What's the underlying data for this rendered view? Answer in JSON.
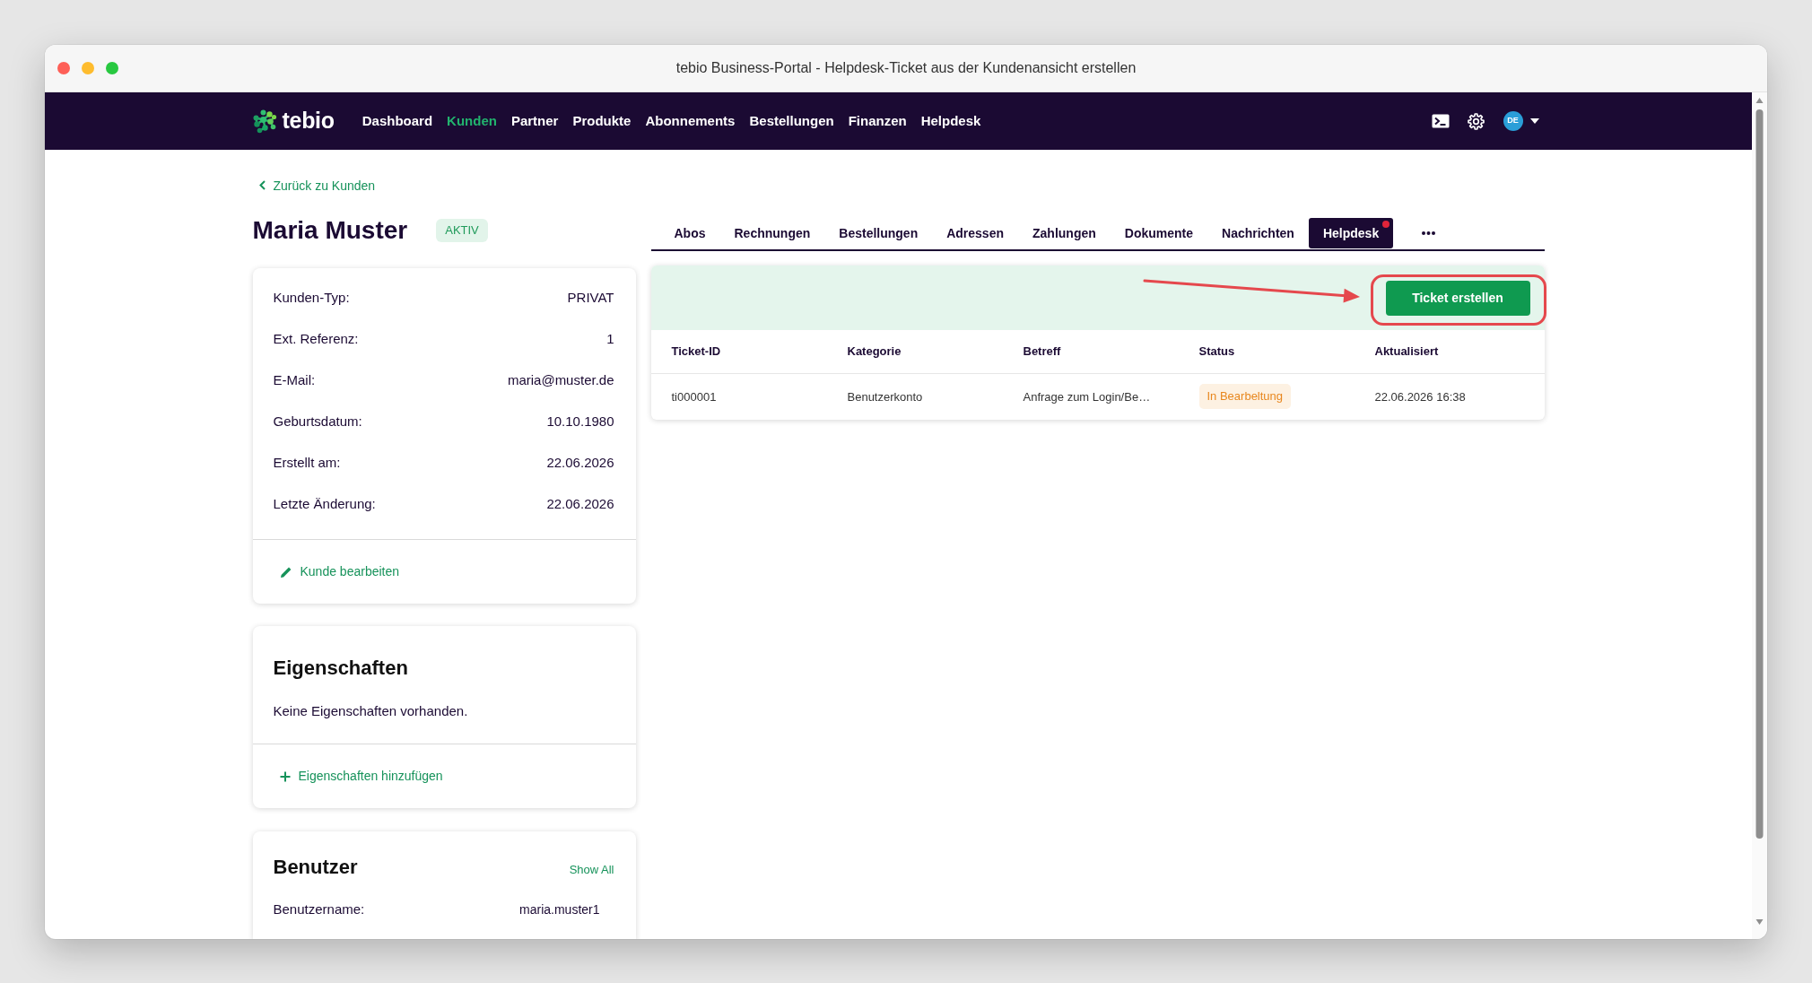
{
  "window": {
    "title": "tebio Business-Portal - Helpdesk-Ticket aus der Kundenansicht erstellen"
  },
  "navbar": {
    "brand": "tebio",
    "links": [
      {
        "label": "Dashboard",
        "selected": false
      },
      {
        "label": "Kunden",
        "selected": true
      },
      {
        "label": "Partner",
        "selected": false
      },
      {
        "label": "Produkte",
        "selected": false
      },
      {
        "label": "Abonnements",
        "selected": false
      },
      {
        "label": "Bestellungen",
        "selected": false
      },
      {
        "label": "Finanzen",
        "selected": false
      },
      {
        "label": "Helpdesk",
        "selected": false
      }
    ],
    "user_initials": "DE"
  },
  "back_link": "Zurück zu Kunden",
  "customer": {
    "name": "Maria Muster",
    "status": "AKTIV"
  },
  "details_card": {
    "fields": [
      {
        "label": "Kunden-Typ:",
        "value": "PRIVAT"
      },
      {
        "label": "Ext. Referenz:",
        "value": "1"
      },
      {
        "label": "E-Mail:",
        "value": "maria@muster.de"
      },
      {
        "label": "Geburtsdatum:",
        "value": "10.10.1980"
      },
      {
        "label": "Erstellt am:",
        "value": "22.06.2026"
      },
      {
        "label": "Letzte Änderung:",
        "value": "22.06.2026"
      }
    ],
    "edit_link": "Kunde bearbeiten"
  },
  "properties_card": {
    "title": "Eigenschaften",
    "empty_text": "Keine Eigenschaften vorhanden.",
    "add_link": "Eigenschaften hinzufügen"
  },
  "users_card": {
    "title": "Benutzer",
    "show_all_link": "Show All",
    "fields": [
      {
        "label": "Benutzername:",
        "value": "maria.muster1"
      }
    ]
  },
  "tabs": [
    {
      "label": "Abos",
      "selected": false,
      "notification": false
    },
    {
      "label": "Rechnungen",
      "selected": false,
      "notification": false
    },
    {
      "label": "Bestellungen",
      "selected": false,
      "notification": false
    },
    {
      "label": "Adressen",
      "selected": false,
      "notification": false
    },
    {
      "label": "Zahlungen",
      "selected": false,
      "notification": false
    },
    {
      "label": "Dokumente",
      "selected": false,
      "notification": false
    },
    {
      "label": "Nachrichten",
      "selected": false,
      "notification": false
    },
    {
      "label": "Helpdesk",
      "selected": true,
      "notification": true
    }
  ],
  "toolbar": {
    "create_button": "Ticket erstellen"
  },
  "table": {
    "columns": [
      {
        "label": "Ticket-ID",
        "kind": "text"
      },
      {
        "label": "Kategorie",
        "kind": "text"
      },
      {
        "label": "Betreff",
        "kind": "text"
      },
      {
        "label": "Status",
        "kind": "badge"
      },
      {
        "label": "Aktualisiert",
        "kind": "text"
      }
    ],
    "rows": [
      {
        "cells": [
          "ti000001",
          "Benutzerkonto",
          "Anfrage zum Login/Be…",
          "In Bearbeltung",
          "22.06.2026 16:38"
        ]
      }
    ]
  }
}
